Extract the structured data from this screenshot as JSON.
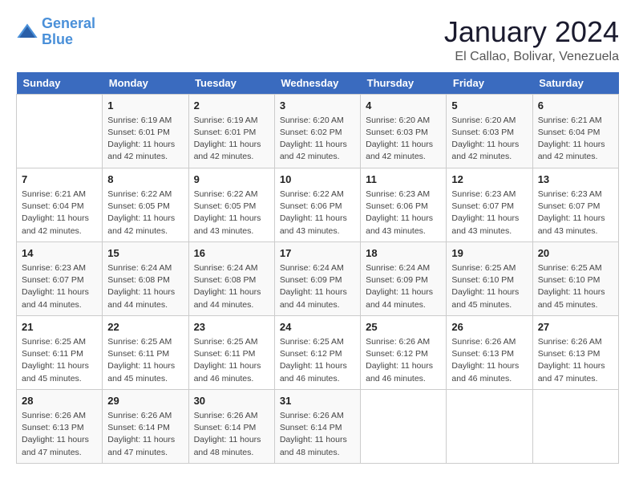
{
  "header": {
    "logo_line1": "General",
    "logo_line2": "Blue",
    "cal_title": "January 2024",
    "cal_subtitle": "El Callao, Bolivar, Venezuela"
  },
  "weekdays": [
    "Sunday",
    "Monday",
    "Tuesday",
    "Wednesday",
    "Thursday",
    "Friday",
    "Saturday"
  ],
  "weeks": [
    [
      {
        "day": "",
        "info": ""
      },
      {
        "day": "1",
        "info": "Sunrise: 6:19 AM\nSunset: 6:01 PM\nDaylight: 11 hours\nand 42 minutes."
      },
      {
        "day": "2",
        "info": "Sunrise: 6:19 AM\nSunset: 6:01 PM\nDaylight: 11 hours\nand 42 minutes."
      },
      {
        "day": "3",
        "info": "Sunrise: 6:20 AM\nSunset: 6:02 PM\nDaylight: 11 hours\nand 42 minutes."
      },
      {
        "day": "4",
        "info": "Sunrise: 6:20 AM\nSunset: 6:03 PM\nDaylight: 11 hours\nand 42 minutes."
      },
      {
        "day": "5",
        "info": "Sunrise: 6:20 AM\nSunset: 6:03 PM\nDaylight: 11 hours\nand 42 minutes."
      },
      {
        "day": "6",
        "info": "Sunrise: 6:21 AM\nSunset: 6:04 PM\nDaylight: 11 hours\nand 42 minutes."
      }
    ],
    [
      {
        "day": "7",
        "info": "Sunrise: 6:21 AM\nSunset: 6:04 PM\nDaylight: 11 hours\nand 42 minutes."
      },
      {
        "day": "8",
        "info": "Sunrise: 6:22 AM\nSunset: 6:05 PM\nDaylight: 11 hours\nand 42 minutes."
      },
      {
        "day": "9",
        "info": "Sunrise: 6:22 AM\nSunset: 6:05 PM\nDaylight: 11 hours\nand 43 minutes."
      },
      {
        "day": "10",
        "info": "Sunrise: 6:22 AM\nSunset: 6:06 PM\nDaylight: 11 hours\nand 43 minutes."
      },
      {
        "day": "11",
        "info": "Sunrise: 6:23 AM\nSunset: 6:06 PM\nDaylight: 11 hours\nand 43 minutes."
      },
      {
        "day": "12",
        "info": "Sunrise: 6:23 AM\nSunset: 6:07 PM\nDaylight: 11 hours\nand 43 minutes."
      },
      {
        "day": "13",
        "info": "Sunrise: 6:23 AM\nSunset: 6:07 PM\nDaylight: 11 hours\nand 43 minutes."
      }
    ],
    [
      {
        "day": "14",
        "info": "Sunrise: 6:23 AM\nSunset: 6:07 PM\nDaylight: 11 hours\nand 44 minutes."
      },
      {
        "day": "15",
        "info": "Sunrise: 6:24 AM\nSunset: 6:08 PM\nDaylight: 11 hours\nand 44 minutes."
      },
      {
        "day": "16",
        "info": "Sunrise: 6:24 AM\nSunset: 6:08 PM\nDaylight: 11 hours\nand 44 minutes."
      },
      {
        "day": "17",
        "info": "Sunrise: 6:24 AM\nSunset: 6:09 PM\nDaylight: 11 hours\nand 44 minutes."
      },
      {
        "day": "18",
        "info": "Sunrise: 6:24 AM\nSunset: 6:09 PM\nDaylight: 11 hours\nand 44 minutes."
      },
      {
        "day": "19",
        "info": "Sunrise: 6:25 AM\nSunset: 6:10 PM\nDaylight: 11 hours\nand 45 minutes."
      },
      {
        "day": "20",
        "info": "Sunrise: 6:25 AM\nSunset: 6:10 PM\nDaylight: 11 hours\nand 45 minutes."
      }
    ],
    [
      {
        "day": "21",
        "info": "Sunrise: 6:25 AM\nSunset: 6:11 PM\nDaylight: 11 hours\nand 45 minutes."
      },
      {
        "day": "22",
        "info": "Sunrise: 6:25 AM\nSunset: 6:11 PM\nDaylight: 11 hours\nand 45 minutes."
      },
      {
        "day": "23",
        "info": "Sunrise: 6:25 AM\nSunset: 6:11 PM\nDaylight: 11 hours\nand 46 minutes."
      },
      {
        "day": "24",
        "info": "Sunrise: 6:25 AM\nSunset: 6:12 PM\nDaylight: 11 hours\nand 46 minutes."
      },
      {
        "day": "25",
        "info": "Sunrise: 6:26 AM\nSunset: 6:12 PM\nDaylight: 11 hours\nand 46 minutes."
      },
      {
        "day": "26",
        "info": "Sunrise: 6:26 AM\nSunset: 6:13 PM\nDaylight: 11 hours\nand 46 minutes."
      },
      {
        "day": "27",
        "info": "Sunrise: 6:26 AM\nSunset: 6:13 PM\nDaylight: 11 hours\nand 47 minutes."
      }
    ],
    [
      {
        "day": "28",
        "info": "Sunrise: 6:26 AM\nSunset: 6:13 PM\nDaylight: 11 hours\nand 47 minutes."
      },
      {
        "day": "29",
        "info": "Sunrise: 6:26 AM\nSunset: 6:14 PM\nDaylight: 11 hours\nand 47 minutes."
      },
      {
        "day": "30",
        "info": "Sunrise: 6:26 AM\nSunset: 6:14 PM\nDaylight: 11 hours\nand 48 minutes."
      },
      {
        "day": "31",
        "info": "Sunrise: 6:26 AM\nSunset: 6:14 PM\nDaylight: 11 hours\nand 48 minutes."
      },
      {
        "day": "",
        "info": ""
      },
      {
        "day": "",
        "info": ""
      },
      {
        "day": "",
        "info": ""
      }
    ]
  ]
}
